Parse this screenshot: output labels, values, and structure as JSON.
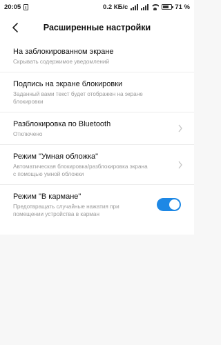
{
  "status_bar": {
    "time": "20:05",
    "speed": "0.2 КБ/с",
    "battery": "71 %",
    "battery_level": 0.71
  },
  "header": {
    "title": "Расширенные настройки"
  },
  "items": [
    {
      "title": "На заблокированном экране",
      "subtitle": "Скрывать содержимое уведомлений"
    },
    {
      "title": "Подпись на экране блокировки",
      "subtitle": "Заданный вами текст будет отображен на экране блокировки"
    },
    {
      "title": "Разблокировка по Bluetooth",
      "subtitle": "Отключено"
    },
    {
      "title": "Режим \"Умная обложка\"",
      "subtitle": "Автоматическая блокировка/разблокировка экрана с помощью умной обложки"
    },
    {
      "title": "Режим \"В кармане\"",
      "subtitle": "Предотвращать случайные нажатия при помещении устройства в карман",
      "toggle_on": true
    }
  ]
}
